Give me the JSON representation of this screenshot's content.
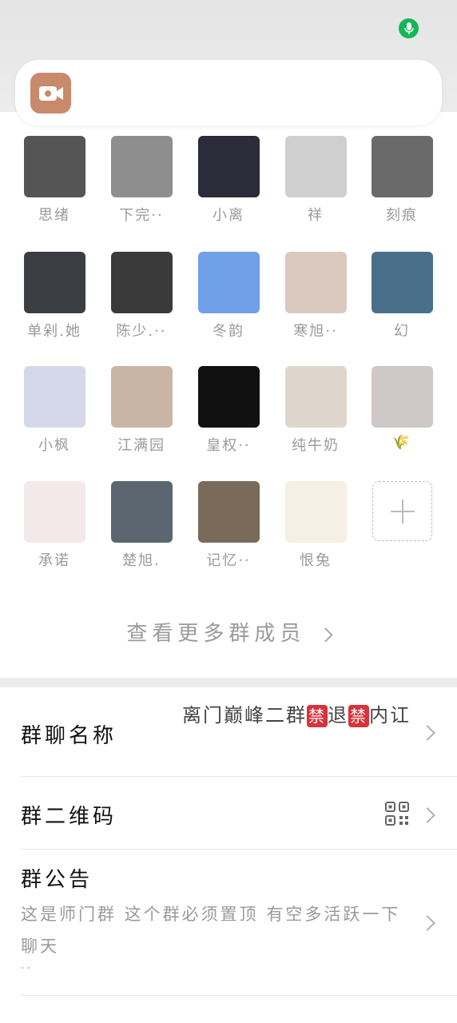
{
  "status": {
    "mic_icon": "microphone-icon",
    "mic_color": "#13b756"
  },
  "call_bar": {
    "icon": "video-camera-icon",
    "icon_color": "#c98a6c"
  },
  "members": [
    {
      "name": "思绪",
      "avatar": "#555555"
    },
    {
      "name": "下完··",
      "avatar": "#8e8e8e"
    },
    {
      "name": "小离",
      "avatar": "#2b2b3a"
    },
    {
      "name": "祥",
      "avatar": "#cfcfcf"
    },
    {
      "name": "刻痕",
      "avatar": "#6a6a6a"
    },
    {
      "name": "单剁.她",
      "avatar": "#3b3f44"
    },
    {
      "name": "陈少.··",
      "avatar": "#3a3a3a"
    },
    {
      "name": "冬韵",
      "avatar": "#6fa0e8"
    },
    {
      "name": "寒旭··",
      "avatar": "#d9c9bf"
    },
    {
      "name": "幻",
      "avatar": "#4a6f8a"
    },
    {
      "name": "小枫",
      "avatar": "#d4d8e8"
    },
    {
      "name": "江满园",
      "avatar": "#c9b5a3"
    },
    {
      "name": "皇权··",
      "avatar": "#111111"
    },
    {
      "name": "纯牛奶",
      "avatar": "#ded6cc"
    },
    {
      "name": "🌾",
      "avatar": "#cfc8c8"
    },
    {
      "name": "承诺",
      "avatar": "#f4e9ea"
    },
    {
      "name": "楚旭.",
      "avatar": "#5b6670"
    },
    {
      "name": "记忆··",
      "avatar": "#7a6a5a"
    },
    {
      "name": "恨兔",
      "avatar": "#f5efe4"
    }
  ],
  "add_member_icon": "plus-icon",
  "more_members_label": "查看更多群成员",
  "settings": {
    "group_name_label": "群聊名称",
    "group_name_part1": "离门巅峰二群",
    "group_name_ban1": "禁",
    "group_name_part2": "退",
    "group_name_ban2": "禁",
    "group_name_part3": "内讧",
    "qr_label": "群二维码",
    "qr_icon": "qr-code-icon",
    "notice_label": "群公告",
    "notice_text": "这是师门群 这个群必须置顶 有空多活跃一下 聊天",
    "notice_more": "··"
  }
}
